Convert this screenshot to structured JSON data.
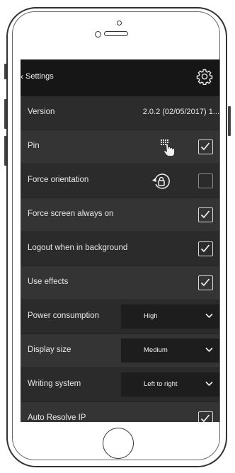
{
  "header": {
    "back_label": "Settings"
  },
  "settings": {
    "version_label": "Version",
    "version_value": "2.0.2 (02/05/2017) 1...",
    "pin_label": "Pin",
    "pin_checked": true,
    "force_orientation_label": "Force orientation",
    "force_orientation_checked": false,
    "screen_on_label": "Force screen always on",
    "screen_on_checked": true,
    "logout_label": "Logout when in background",
    "logout_checked": true,
    "effects_label": "Use effects",
    "effects_checked": true,
    "power_label": "Power consumption",
    "power_value": "High",
    "display_label": "Display size",
    "display_value": "Medium",
    "writing_label": "Writing system",
    "writing_value": "Left to right",
    "auto_ip_label": "Auto Resolve IP",
    "auto_ip_checked": true
  },
  "icons": {
    "back": "chevron-left-icon",
    "settings": "gear-icon",
    "pin": "keypad-hand-icon",
    "orientation": "rotation-lock-icon",
    "dropdown": "chevron-down-icon",
    "check": "checkmark-icon"
  },
  "colors": {
    "header_bg": "#161616",
    "row_bg": "#2e2e2e",
    "select_bg": "#1d1d1d",
    "text": "#e8e8e8"
  }
}
